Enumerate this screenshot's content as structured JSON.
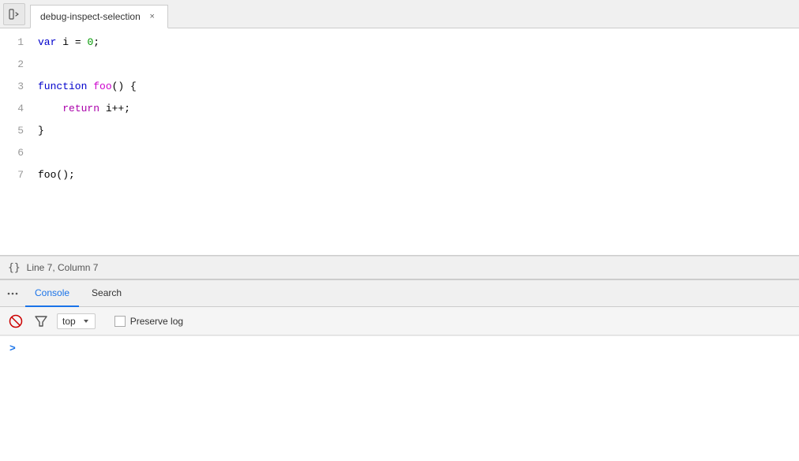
{
  "tab": {
    "title": "debug-inspect-selection",
    "close_label": "×"
  },
  "code": {
    "lines": [
      {
        "num": "1",
        "tokens": [
          {
            "text": "var ",
            "class": "kw-blue"
          },
          {
            "text": "i",
            "class": ""
          },
          {
            "text": " = ",
            "class": ""
          },
          {
            "text": "0",
            "class": "num"
          },
          {
            "text": ";",
            "class": ""
          }
        ]
      },
      {
        "num": "2",
        "tokens": []
      },
      {
        "num": "3",
        "tokens": [
          {
            "text": "function ",
            "class": "kw-blue"
          },
          {
            "text": "foo",
            "class": "fn"
          },
          {
            "text": "() {",
            "class": ""
          }
        ]
      },
      {
        "num": "4",
        "tokens": [
          {
            "text": "    ",
            "class": ""
          },
          {
            "text": "return ",
            "class": "kw-purple"
          },
          {
            "text": "i++;",
            "class": ""
          }
        ]
      },
      {
        "num": "5",
        "tokens": [
          {
            "text": "}",
            "class": ""
          }
        ]
      },
      {
        "num": "6",
        "tokens": []
      },
      {
        "num": "7",
        "tokens": [
          {
            "text": "foo();",
            "class": ""
          }
        ]
      }
    ]
  },
  "status": {
    "position": "Line 7, Column 7"
  },
  "console": {
    "tabs": [
      {
        "label": "Console",
        "active": true
      },
      {
        "label": "Search",
        "active": false
      }
    ],
    "toolbar": {
      "filter_label": "top",
      "preserve_log_label": "Preserve log"
    },
    "prompt_symbol": ">"
  }
}
